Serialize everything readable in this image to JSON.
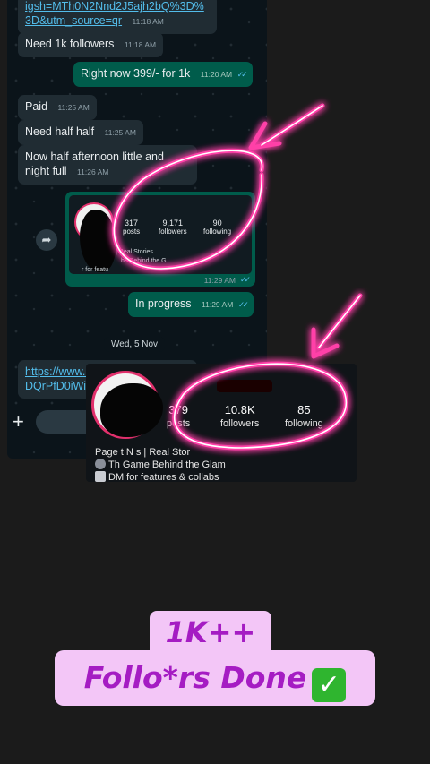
{
  "chat": {
    "messages": [
      {
        "text": "igsh=MTh0N2Nnd2J5ajh2bQ%3D%3D&utm_source=qr",
        "time": "11:18 AM"
      },
      {
        "text": "Need 1k followers",
        "time": "11:18 AM"
      },
      {
        "text": "Right now 399/- for 1k",
        "time": "11:20 AM"
      },
      {
        "text": "Paid",
        "time": "11:25 AM"
      },
      {
        "text": "Need half half",
        "time": "11:25 AM"
      },
      {
        "text": "Now half afternoon little and night full",
        "time": "11:26 AM"
      },
      {
        "text": "In progress",
        "time": "11:29 AM"
      },
      {
        "text": "https://www.instagram.com/reel/DQrPfD0iWi?igsh=MXE1M",
        "time": ""
      }
    ],
    "shared_card": {
      "posts_value": "317",
      "posts_label": "posts",
      "followers_value": "9,171",
      "followers_label": "followers",
      "following_value": "90",
      "following_label": "following",
      "bio": "| Real Stories",
      "bio2": "he Behind the G",
      "bio3": "r for featu",
      "time": "11:29 AM"
    },
    "day_separator": "Wed, 5 Nov"
  },
  "profile": {
    "posts_value": "379",
    "posts_label": "posts",
    "followers_value": "10.8K",
    "followers_label": "followers",
    "following_value": "85",
    "following_label": "following",
    "bio_line1": "Page   t N  s | Real Stor",
    "bio_line2": "Th   Game Behind the Glam",
    "bio_line3": "DM for features & collabs"
  },
  "caption": {
    "line1": "1K++",
    "line2": "Follo*rs Done"
  },
  "colors": {
    "neon": "#ff3fa8",
    "caption_bg": "#f3c6f7",
    "caption_text": "#a51cc3"
  },
  "icons": [
    "share-icon",
    "plus-icon",
    "double-check-icon",
    "check-box-icon",
    "microphone-icon",
    "inbox-icon",
    "arrow-icon"
  ]
}
